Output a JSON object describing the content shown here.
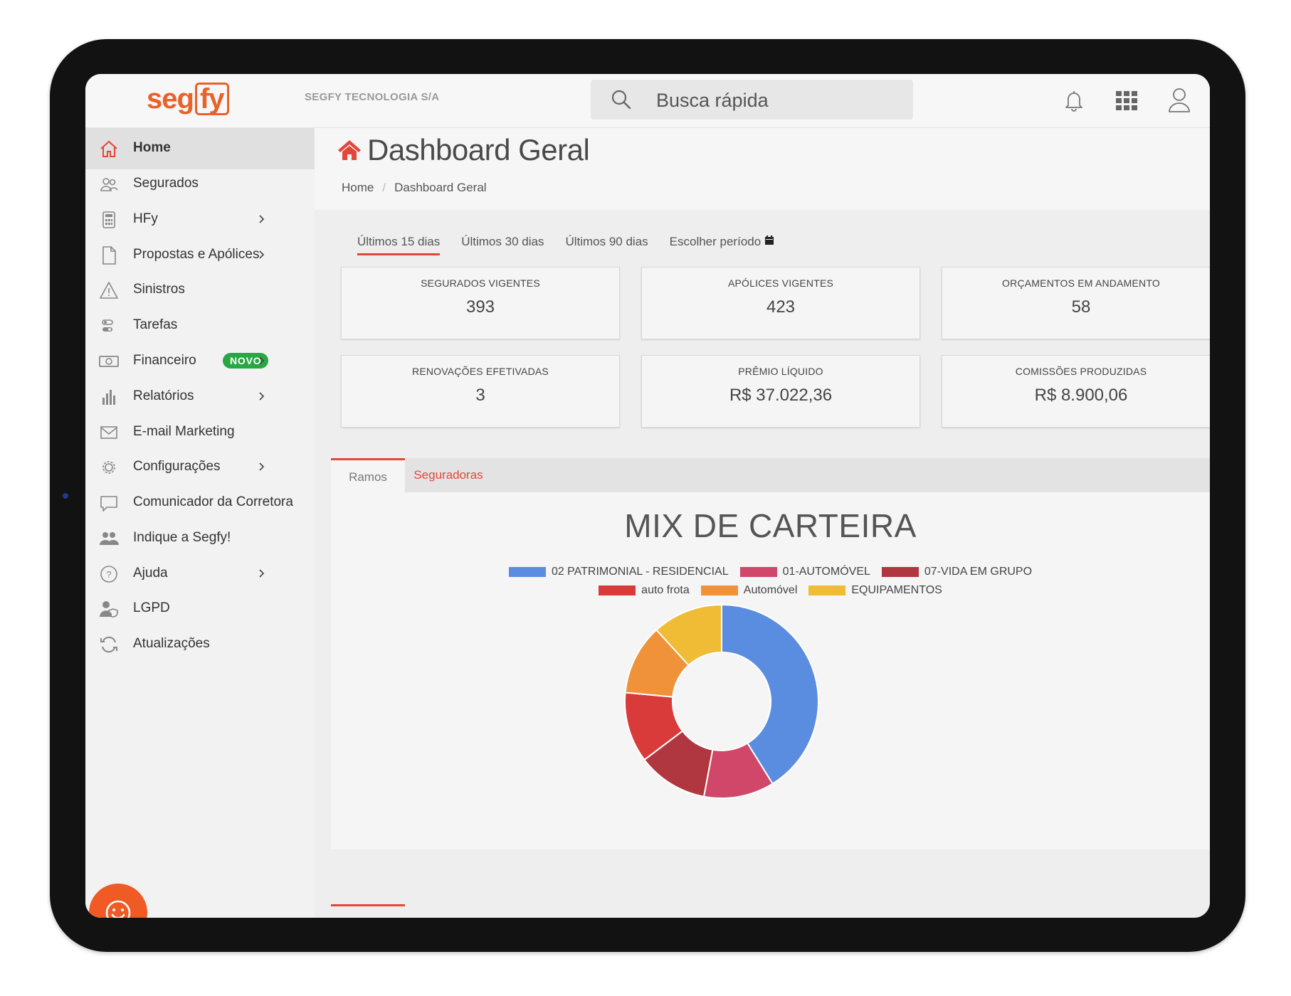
{
  "topbar": {
    "logo_left": "seg",
    "logo_right": "fy",
    "company": "SEGFY TECNOLOGIA S/A",
    "search_placeholder": "Busca rápida"
  },
  "sidebar": {
    "items": [
      {
        "label": "Home",
        "icon": "home-icon",
        "active": true
      },
      {
        "label": "Segurados",
        "icon": "users-icon"
      },
      {
        "label": "HFy",
        "icon": "calculator-icon",
        "has_chevron": true
      },
      {
        "label": "Propostas e Apólices",
        "icon": "document-icon",
        "has_chevron": true
      },
      {
        "label": "Sinistros",
        "icon": "warning-icon"
      },
      {
        "label": "Tarefas",
        "icon": "tasks-icon"
      },
      {
        "label": "Financeiro",
        "icon": "money-icon",
        "has_chevron": true,
        "badge": "NOVO"
      },
      {
        "label": "Relatórios",
        "icon": "bar-chart-icon",
        "has_chevron": true
      },
      {
        "label": "E-mail Marketing",
        "icon": "envelope-icon"
      },
      {
        "label": "Configurações",
        "icon": "gear-icon",
        "has_chevron": true
      },
      {
        "label": "Comunicador da Corretora",
        "icon": "chat-bubble-icon"
      },
      {
        "label": "Indique a Segfy!",
        "icon": "group-icon"
      },
      {
        "label": "Ajuda",
        "icon": "help-icon",
        "has_chevron": true
      },
      {
        "label": "LGPD",
        "icon": "user-shield-icon"
      },
      {
        "label": "Atualizações",
        "icon": "refresh-icon"
      }
    ]
  },
  "main": {
    "title": "Dashboard Geral",
    "breadcrumb": [
      "Home",
      "Dashboard Geral"
    ],
    "periods": [
      "Últimos 15 dias",
      "Últimos 30 dias",
      "Últimos 90 dias",
      "Escolher período"
    ],
    "kpis": [
      {
        "title": "SEGURADOS VIGENTES",
        "value": "393"
      },
      {
        "title": "APÓLICES VIGENTES",
        "value": "423"
      },
      {
        "title": "ORÇAMENTOS EM ANDAMENTO",
        "value": "58"
      },
      {
        "title": "RENOVAÇÕES EFETIVADAS",
        "value": "3"
      },
      {
        "title": "PRÊMIO LÍQUIDO",
        "value": "R$ 37.022,36"
      },
      {
        "title": "COMISSÕES PRODUZIDAS",
        "value": "R$ 8.900,06"
      }
    ],
    "tabs": [
      "Ramos",
      "Seguradoras"
    ]
  },
  "colors": {
    "accent": "#e4463a",
    "brand": "#e8622a",
    "badge": "#27a844"
  },
  "chart_data": {
    "type": "pie",
    "variant": "doughnut",
    "title": "MIX DE CARTEIRA",
    "legend_position": "top",
    "categories": [
      "02 PATRIMONIAL - RESIDENCIAL",
      "01-AUTOMÓVEL",
      "07-VIDA EM GRUPO",
      "auto frota",
      "Automóvel",
      "EQUIPAMENTOS"
    ],
    "values": [
      35,
      10,
      10,
      10,
      10,
      10
    ],
    "colors": [
      "#5a8de0",
      "#d0476a",
      "#b0373f",
      "#d93a3a",
      "#ef923a",
      "#f0bb35"
    ]
  }
}
